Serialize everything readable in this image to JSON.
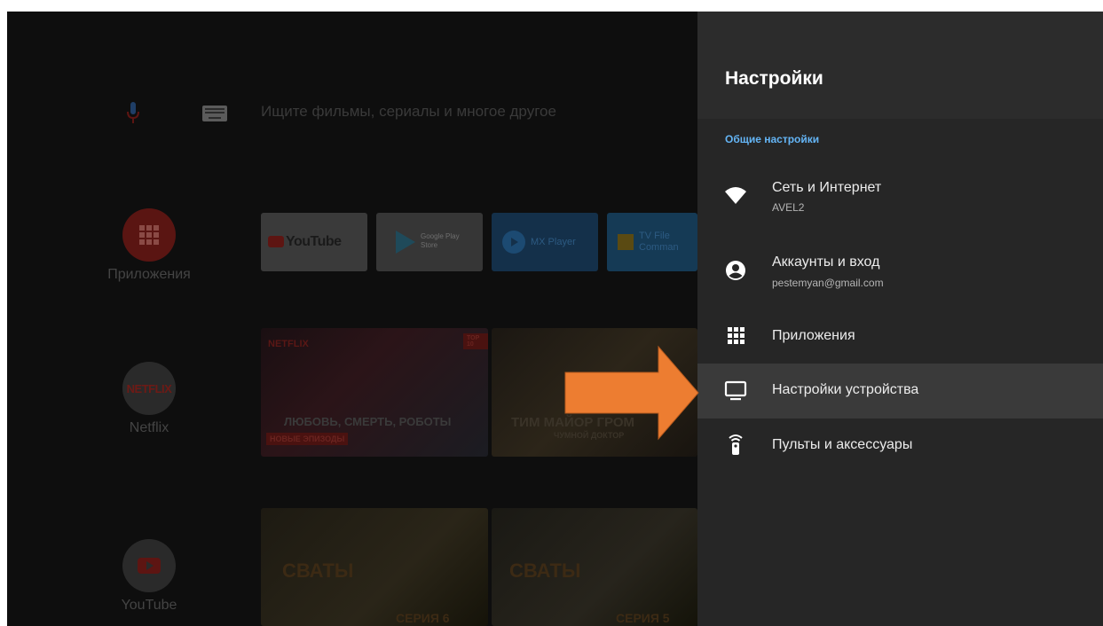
{
  "home": {
    "search_hint": "Ищите фильмы, сериалы и многое другое",
    "side_items": [
      {
        "label": "Приложения"
      },
      {
        "label": "Netflix",
        "logo_text": "NETFLIX"
      },
      {
        "label": "YouTube"
      }
    ],
    "tiles": {
      "youtube": "YouTube",
      "google_play_line1": "Google Play",
      "google_play_line2": "Store",
      "mx_player": "MX Player",
      "tv_file_line1": "TV File",
      "tv_file_line2": "Comman"
    },
    "posters": {
      "a_brand": "NETFLIX",
      "a_top_badge": "TOP 10",
      "a_title": "ЛЮБОВЬ, СМЕРТЬ, РОБОТЫ",
      "a_badge": "НОВЫЕ ЭПИЗОДЫ",
      "b_title": "ТИМ МАЙОР ГРОМ",
      "b_subtitle": "ЧУМНОЙ ДОКТОР",
      "c_title": "СВАТЫ",
      "c_episode": "СЕРИЯ 6",
      "d_title": "СВАТЫ",
      "d_episode": "СЕРИЯ 5"
    }
  },
  "panel": {
    "title": "Настройки",
    "section_title": "Общие настройки",
    "items": [
      {
        "icon": "wifi-icon",
        "title": "Сеть и Интернет",
        "subtitle": "AVEL2"
      },
      {
        "icon": "account-icon",
        "title": "Аккаунты и вход",
        "subtitle": "pestemyan@gmail.com"
      },
      {
        "icon": "apps-grid-icon",
        "title": "Приложения",
        "subtitle": ""
      },
      {
        "icon": "tv-icon",
        "title": "Настройки устройства",
        "subtitle": "",
        "selected": true
      },
      {
        "icon": "remote-icon",
        "title": "Пульты и аксессуары",
        "subtitle": ""
      }
    ]
  },
  "colors": {
    "panel_bg": "#262626",
    "panel_header_bg": "#2c2c2c",
    "selected_bg": "#3a3a3a",
    "section_accent": "#64b5f6",
    "arrow": "#ed7d31"
  }
}
